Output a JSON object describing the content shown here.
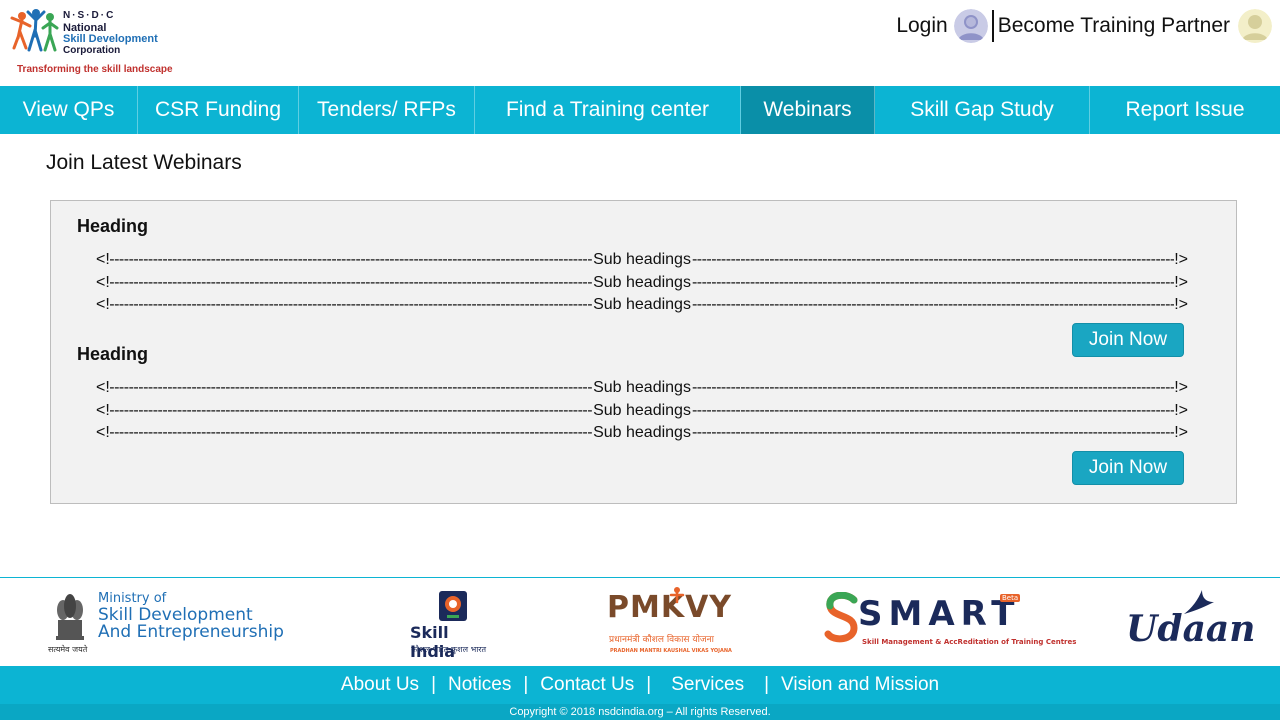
{
  "header": {
    "logo": {
      "abbr": "N·S·D·C",
      "line1": "National",
      "line2": "Skill Development",
      "line3": "Corporation",
      "tagline": "Transforming the skill landscape"
    },
    "login_label": "Login",
    "partner_label": "Become Training Partner"
  },
  "nav": {
    "items": [
      {
        "label": "View QPs"
      },
      {
        "label": "CSR Funding"
      },
      {
        "label": "Tenders/ RFPs"
      },
      {
        "label": "Find a Training center"
      },
      {
        "label": "Webinars",
        "active": true
      },
      {
        "label": "Skill Gap Study"
      },
      {
        "label": "Report Issue"
      }
    ],
    "color": "#0cb4d3",
    "active_color": "#0a8fa8"
  },
  "main": {
    "title": "Join Latest Webinars",
    "webinars": [
      {
        "heading": "Heading",
        "subheadings": [
          "Sub headings",
          "Sub headings",
          "Sub headings"
        ],
        "button_label": "Join Now"
      },
      {
        "heading": "Heading",
        "subheadings": [
          "Sub headings",
          "Sub headings",
          "Sub headings"
        ],
        "button_label": "Join Now"
      }
    ],
    "sub_prefix": "<!",
    "sub_suffix": "!>"
  },
  "footer": {
    "logos": {
      "ministry": {
        "line1": "Ministry of",
        "line2": "Skill Development",
        "line3": "And Entrepreneurship",
        "caption": "सत्यमेव जयते"
      },
      "skill_india": {
        "title": "Skill India",
        "caption": "कौशल भारत-कुशल भारत"
      },
      "pmkvy": {
        "title": "PMKVY",
        "hindi": "प्रधानमंत्री कौशल विकास योजना",
        "caption": "PRADHAN MANTRI KAUSHAL VIKAS YOJANA"
      },
      "smart": {
        "title": "SMART",
        "badge": "Beta",
        "caption": "Skill Management & AccReditation of Training Centres"
      },
      "udaan": {
        "title": "Udaan"
      }
    },
    "links": [
      "About Us",
      "Notices",
      "Contact Us",
      "Services",
      "Vision and Mission"
    ],
    "copyright": "Copyright © 2018 nsdcindia.org – All rights Reserved."
  }
}
